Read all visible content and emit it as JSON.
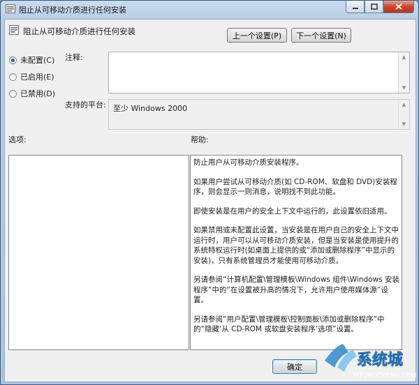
{
  "window": {
    "title": "阻止从可移动介质进行任何安装",
    "controls": [
      "minimize-icon",
      "maximize-icon",
      "close-icon"
    ]
  },
  "header": {
    "policy_title": "阻止从可移动介质进行任何安装",
    "prev_button": "上一个设置(P)",
    "next_button": "下一个设置(N)"
  },
  "state": {
    "options": [
      {
        "label": "未配置(C)",
        "selected": true
      },
      {
        "label": "已启用(E)",
        "selected": false
      },
      {
        "label": "已禁用(D)",
        "selected": false
      }
    ]
  },
  "comment": {
    "label": "注释:",
    "value": ""
  },
  "platform": {
    "label": "支持的平台:",
    "value": "至少 Windows 2000"
  },
  "options_section": {
    "label": "选项:"
  },
  "help_section": {
    "label": "帮助:",
    "paragraphs": [
      "防止用户从可移动介质安装程序。",
      "如果用户尝试从可移动介质(如 CD-ROM、软盘和 DVD)安装程序，则会显示一则消息，说明找不到此功能。",
      "即使安装是在用户的安全上下文中运行的，此设置依旧适用。",
      "如果禁用或未配置此设置，当安装是在用户自己的安全上下文中运行时，用户可以从可移动介质安装，但是当安装是使用提升的系统特权运行时(如桌面上提供的或“添加或删除程序”中显示的安装)，只有系统管理员才能使用可移动介质。",
      "另请参阅“计算机配置\\管理模板\\Windows 组件\\Windows 安装程序”中的“在设置被升高的情况下，允许用户使用媒体源”设置。",
      "另请参阅“用户配置\\管理模板\\控制面板\\添加或删除程序”中的“隐藏‘从 CD-ROM 或软盘安装程序’选项”设置。"
    ]
  },
  "footer": {
    "ok_button": "确定"
  },
  "watermark": {
    "text": "系统城",
    "sub": "XITONGCHENG.COM"
  },
  "colors": {
    "accent": "#2a5fa0",
    "window_frame": "#b7cde6",
    "close_button": "#c9452c"
  }
}
